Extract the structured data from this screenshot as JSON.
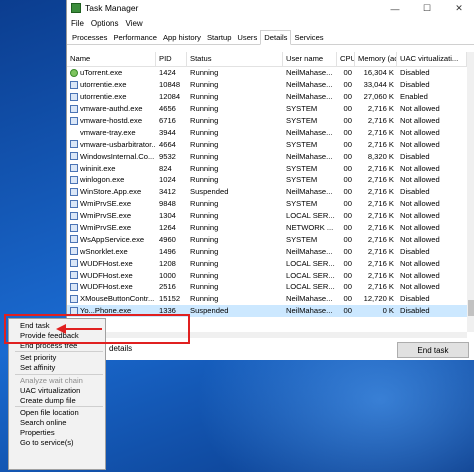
{
  "window": {
    "title": "Task Manager",
    "controls": [
      "—",
      "☐",
      "✕"
    ]
  },
  "menu": [
    "File",
    "Options",
    "View"
  ],
  "tabs": [
    "Processes",
    "Performance",
    "App history",
    "Startup",
    "Users",
    "Details",
    "Services"
  ],
  "active_tab": "Details",
  "columns": {
    "name": "Name",
    "pid": "PID",
    "status": "Status",
    "user": "User name",
    "cpu": "CPU",
    "mem": "Memory (ac...",
    "uac": "UAC virtualizati..."
  },
  "rows": [
    {
      "name": "uTorrent.exe",
      "pid": "1424",
      "status": "Running",
      "user": "NeilMahase...",
      "cpu": "00",
      "mem": "16,304 K",
      "uac": "Disabled",
      "icon": "green"
    },
    {
      "name": "utorrentie.exe",
      "pid": "10848",
      "status": "Running",
      "user": "NeilMahase...",
      "cpu": "00",
      "mem": "33,044 K",
      "uac": "Disabled",
      "icon": "app"
    },
    {
      "name": "utorrentie.exe",
      "pid": "12084",
      "status": "Running",
      "user": "NeilMahase...",
      "cpu": "00",
      "mem": "27,060 K",
      "uac": "Enabled",
      "icon": "app"
    },
    {
      "name": "vmware-authd.exe",
      "pid": "4656",
      "status": "Running",
      "user": "SYSTEM",
      "cpu": "00",
      "mem": "2,716 K",
      "uac": "Not allowed",
      "icon": "app"
    },
    {
      "name": "vmware-hostd.exe",
      "pid": "6716",
      "status": "Running",
      "user": "SYSTEM",
      "cpu": "00",
      "mem": "2,716 K",
      "uac": "Not allowed",
      "icon": "app"
    },
    {
      "name": "vmware-tray.exe",
      "pid": "3944",
      "status": "Running",
      "user": "NeilMahase...",
      "cpu": "00",
      "mem": "2,716 K",
      "uac": "Not allowed",
      "icon": "none"
    },
    {
      "name": "vmware-usbarbitrator...",
      "pid": "4664",
      "status": "Running",
      "user": "SYSTEM",
      "cpu": "00",
      "mem": "2,716 K",
      "uac": "Not allowed",
      "icon": "app"
    },
    {
      "name": "WindowsInternal.Co...",
      "pid": "9532",
      "status": "Running",
      "user": "NeilMahase...",
      "cpu": "00",
      "mem": "8,320 K",
      "uac": "Disabled",
      "icon": "app"
    },
    {
      "name": "wininit.exe",
      "pid": "824",
      "status": "Running",
      "user": "SYSTEM",
      "cpu": "00",
      "mem": "2,716 K",
      "uac": "Not allowed",
      "icon": "app"
    },
    {
      "name": "winlogon.exe",
      "pid": "1024",
      "status": "Running",
      "user": "SYSTEM",
      "cpu": "00",
      "mem": "2,716 K",
      "uac": "Not allowed",
      "icon": "app"
    },
    {
      "name": "WinStore.App.exe",
      "pid": "3412",
      "status": "Suspended",
      "user": "NeilMahase...",
      "cpu": "00",
      "mem": "2,716 K",
      "uac": "Disabled",
      "icon": "app"
    },
    {
      "name": "WmiPrvSE.exe",
      "pid": "9848",
      "status": "Running",
      "user": "SYSTEM",
      "cpu": "00",
      "mem": "2,716 K",
      "uac": "Not allowed",
      "icon": "app"
    },
    {
      "name": "WmiPrvSE.exe",
      "pid": "1304",
      "status": "Running",
      "user": "LOCAL SER...",
      "cpu": "00",
      "mem": "2,716 K",
      "uac": "Not allowed",
      "icon": "app"
    },
    {
      "name": "WmiPrvSE.exe",
      "pid": "1264",
      "status": "Running",
      "user": "NETWORK ...",
      "cpu": "00",
      "mem": "2,716 K",
      "uac": "Not allowed",
      "icon": "app"
    },
    {
      "name": "WsAppService.exe",
      "pid": "4960",
      "status": "Running",
      "user": "SYSTEM",
      "cpu": "00",
      "mem": "2,716 K",
      "uac": "Not allowed",
      "icon": "app"
    },
    {
      "name": "wSnorklet.exe",
      "pid": "1496",
      "status": "Running",
      "user": "NeilMahase...",
      "cpu": "00",
      "mem": "2,716 K",
      "uac": "Disabled",
      "icon": "app"
    },
    {
      "name": "WUDFHost.exe",
      "pid": "1208",
      "status": "Running",
      "user": "LOCAL SER...",
      "cpu": "00",
      "mem": "2,716 K",
      "uac": "Not allowed",
      "icon": "app"
    },
    {
      "name": "WUDFHost.exe",
      "pid": "1000",
      "status": "Running",
      "user": "LOCAL SER...",
      "cpu": "00",
      "mem": "2,716 K",
      "uac": "Not allowed",
      "icon": "app"
    },
    {
      "name": "WUDFHost.exe",
      "pid": "2516",
      "status": "Running",
      "user": "LOCAL SER...",
      "cpu": "00",
      "mem": "2,716 K",
      "uac": "Not allowed",
      "icon": "app"
    },
    {
      "name": "XMouseButtonContr...",
      "pid": "15152",
      "status": "Running",
      "user": "NeilMahase...",
      "cpu": "00",
      "mem": "12,720 K",
      "uac": "Disabled",
      "icon": "app"
    },
    {
      "name": "Yo...Phone.exe",
      "pid": "1336",
      "status": "Suspended",
      "user": "NeilMahase...",
      "cpu": "00",
      "mem": "0 K",
      "uac": "Disabled",
      "icon": "app",
      "selected": true
    }
  ],
  "footer": {
    "fewer_details": "details",
    "end_task": "End task"
  },
  "context_menu": {
    "groups": [
      [
        {
          "label": "End task"
        },
        {
          "label": "Provide feedback"
        },
        {
          "label": "End process tree"
        }
      ],
      [
        {
          "label": "Set priority",
          "submenu": true
        },
        {
          "label": "Set affinity"
        }
      ],
      [
        {
          "label": "Analyze wait chain",
          "disabled": true
        },
        {
          "label": "UAC virtualization"
        },
        {
          "label": "Create dump file"
        }
      ],
      [
        {
          "label": "Open file location"
        },
        {
          "label": "Search online"
        },
        {
          "label": "Properties"
        },
        {
          "label": "Go to service(s)"
        }
      ]
    ],
    "submenu_arrow": "›"
  },
  "colors": {
    "highlight": "#e02020",
    "selection": "#cce8ff",
    "desktop": "#1560b8"
  }
}
